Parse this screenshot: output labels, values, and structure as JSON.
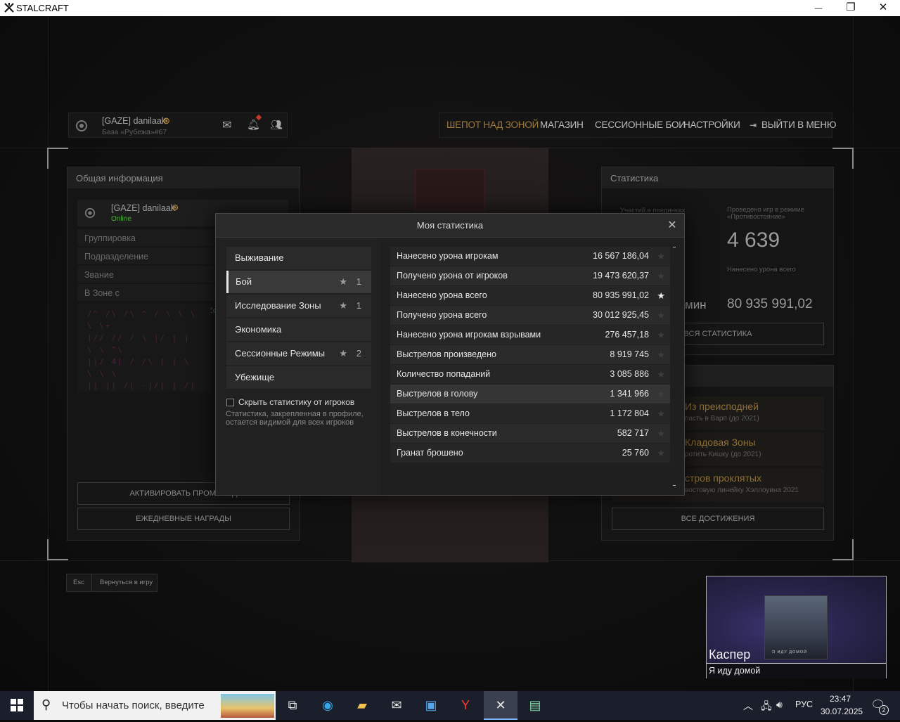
{
  "window": {
    "title": "STALCRAFT",
    "minimize_glyph": "—",
    "maximize_glyph": "❐",
    "close_glyph": "✕"
  },
  "topbar": {
    "player_name": "[GAZE] danilaak",
    "player_base": "База «Рубежа»#67",
    "menu": [
      "ШЕПОТ НАД ЗОНОЙ",
      "МАГАЗИН",
      "СЕССИОННЫЕ БОИ",
      "НАСТРОЙКИ",
      "ВЫЙТИ В МЕНЮ"
    ]
  },
  "left_panel": {
    "title": "Общая информация",
    "player_name": "[GAZE] danilaak",
    "status": "Online",
    "rows": [
      "Группировка",
      "Подразделение",
      "Звание",
      "В Зоне с"
    ],
    "zone_fragment": "Zo",
    "buttons": [
      "АКТИВИРОВАТЬ ПРОМОКОД",
      "ЕЖЕДНЕВНЫЕ НАГРАДЫ"
    ]
  },
  "right_panel": {
    "title": "Статистика",
    "cells": [
      {
        "label": "Участий в поединках",
        "value": ""
      },
      {
        "label": "Проведено игр в режиме «Противостояние»",
        "value": "4 639"
      },
      {
        "label": "",
        "value": "мин"
      },
      {
        "label": "Нанесено урона всего",
        "value": "80 935 991,02"
      }
    ],
    "all_stats_button": "ВСЯ СТАТИСТИКА",
    "achievements": [
      {
        "title": "Из преисподней",
        "sub": "пасть в Варп (до 2021)"
      },
      {
        "title": "Кладовая Зоны",
        "sub": "ротить Кишку (до 2021)"
      },
      {
        "title": "стров проклятых",
        "sub": "востовую линейку Хэллоуина 2021"
      }
    ],
    "all_achievements_button": "ВСЕ ДОСТИЖЕНИЯ"
  },
  "bottom": {
    "esc_key": "Esc",
    "return_label": "Вернуться в игру"
  },
  "modal": {
    "title": "Моя статистика",
    "close_glyph": "✕",
    "categories": [
      {
        "label": "Выживание",
        "starred": false,
        "count": ""
      },
      {
        "label": "Бой",
        "starred": true,
        "count": "1",
        "active": true
      },
      {
        "label": "Исследование Зоны",
        "starred": true,
        "count": "1"
      },
      {
        "label": "Экономика",
        "starred": false,
        "count": ""
      },
      {
        "label": "Сессионные Режимы",
        "starred": true,
        "count": "2"
      },
      {
        "label": "Убежище",
        "starred": false,
        "count": ""
      }
    ],
    "hide_checkbox_label": "Скрыть статистику от игроков",
    "hide_note": "Статистика, закрепленная в профиле, остается видимой для всех игроков",
    "stats": [
      {
        "label": "Нанесено урона игрокам",
        "value": "16 567 186,04",
        "pinned": false
      },
      {
        "label": "Получено урона от игроков",
        "value": "19 473 620,37",
        "pinned": false
      },
      {
        "label": "Нанесено урона всего",
        "value": "80 935 991,02",
        "pinned": true
      },
      {
        "label": "Получено урона всего",
        "value": "30 012 925,45",
        "pinned": false
      },
      {
        "label": "Нанесено урона игрокам взрывами",
        "value": "276 457,18",
        "pinned": false
      },
      {
        "label": "Выстрелов произведено",
        "value": "8 919 745",
        "pinned": false
      },
      {
        "label": "Количество попаданий",
        "value": "3 085 886",
        "pinned": false
      },
      {
        "label": "Выстрелов в голову",
        "value": "1 341 966",
        "pinned": false,
        "highlighted": true
      },
      {
        "label": "Выстрелов в тело",
        "value": "1 172 804",
        "pinned": false
      },
      {
        "label": "Выстрелов в конечности",
        "value": "582 717",
        "pinned": false
      },
      {
        "label": "Гранат брошено",
        "value": "25 760",
        "pinned": false
      }
    ]
  },
  "music_popup": {
    "artist": "Каспер",
    "track": "Я иду домой",
    "cover_caption": "Я ИДУ ДОМОЙ"
  },
  "taskbar": {
    "search_placeholder": "Чтобы начать поиск, введите",
    "language": "РУС",
    "time": "23:47",
    "date": "30.07.2025",
    "notification_count": "2"
  },
  "colors": {
    "accent_orange": "#c79a46",
    "online_green": "#4caf3a",
    "modal_bg": "#222222"
  }
}
